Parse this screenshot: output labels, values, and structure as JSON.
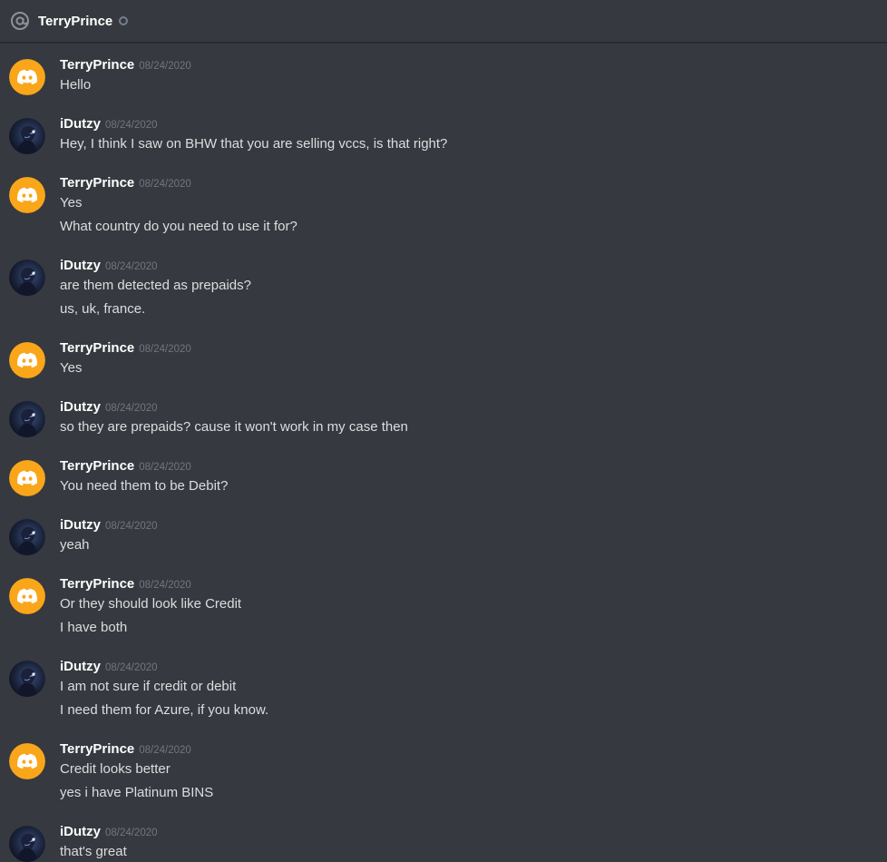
{
  "header": {
    "icon": "at-sign-icon",
    "title": "TerryPrince",
    "status": "offline"
  },
  "colors": {
    "background": "#36393f",
    "terry_avatar": "#faa61a",
    "timestamp": "#72767d"
  },
  "messages": [
    {
      "author": "TerryPrince",
      "avatar": "discord-logo-icon",
      "time": "08/24/2020",
      "lines": [
        "Hello"
      ]
    },
    {
      "author": "iDutzy",
      "avatar": "user-avatar-image",
      "time": "08/24/2020",
      "lines": [
        "Hey, I think I saw on BHW that you are selling vccs, is that right?"
      ]
    },
    {
      "author": "TerryPrince",
      "avatar": "discord-logo-icon",
      "time": "08/24/2020",
      "lines": [
        "Yes",
        "What country do you need to use it for?"
      ]
    },
    {
      "author": "iDutzy",
      "avatar": "user-avatar-image",
      "time": "08/24/2020",
      "lines": [
        "are them detected as prepaids?",
        "us, uk, france."
      ]
    },
    {
      "author": "TerryPrince",
      "avatar": "discord-logo-icon",
      "time": "08/24/2020",
      "lines": [
        "Yes"
      ]
    },
    {
      "author": "iDutzy",
      "avatar": "user-avatar-image",
      "time": "08/24/2020",
      "lines": [
        "so they are prepaids? cause it won't work in my case then"
      ]
    },
    {
      "author": "TerryPrince",
      "avatar": "discord-logo-icon",
      "time": "08/24/2020",
      "lines": [
        "You need them to be Debit?"
      ]
    },
    {
      "author": "iDutzy",
      "avatar": "user-avatar-image",
      "time": "08/24/2020",
      "lines": [
        "yeah"
      ]
    },
    {
      "author": "TerryPrince",
      "avatar": "discord-logo-icon",
      "time": "08/24/2020",
      "lines": [
        "Or they should look like Credit",
        "I have both"
      ]
    },
    {
      "author": "iDutzy",
      "avatar": "user-avatar-image",
      "time": "08/24/2020",
      "lines": [
        "I am not sure if credit or debit",
        "I need them for Azure, if you know."
      ]
    },
    {
      "author": "TerryPrince",
      "avatar": "discord-logo-icon",
      "time": "08/24/2020",
      "lines": [
        "Credit looks better",
        "yes i have Platinum BINS"
      ]
    },
    {
      "author": "iDutzy",
      "avatar": "user-avatar-image",
      "time": "08/24/2020",
      "lines": [
        "that's great"
      ]
    }
  ]
}
